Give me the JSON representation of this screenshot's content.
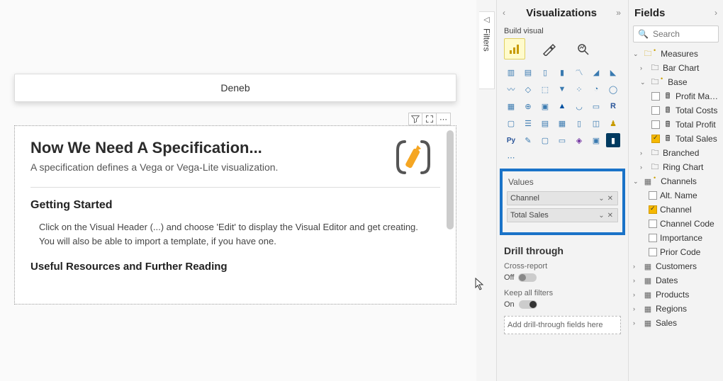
{
  "canvas": {
    "visual_title": "Deneb",
    "spec_title": "Now We Need A Specification...",
    "spec_sub": "A specification defines a Vega or Vega-Lite visualization.",
    "getting_started_title": "Getting Started",
    "getting_started_body": "Click on the Visual Header (...) and choose 'Edit' to display the Visual Editor and get creating. You will also be able to import a template, if you have one.",
    "useful_resources_title": "Useful Resources and Further Reading"
  },
  "filters": {
    "label": "Filters"
  },
  "viz": {
    "title": "Visualizations",
    "build_label": "Build visual",
    "values_label": "Values",
    "fields": [
      {
        "name": "Channel"
      },
      {
        "name": "Total Sales"
      }
    ],
    "drill_title": "Drill through",
    "cross_report_label": "Cross-report",
    "cross_report_state": "Off",
    "keep_filters_label": "Keep all filters",
    "keep_filters_state": "On",
    "drill_placeholder": "Add drill-through fields here"
  },
  "fields": {
    "title": "Fields",
    "search_placeholder": "Search",
    "measures": {
      "label": "Measures",
      "bar_chart": "Bar Chart",
      "base": {
        "label": "Base",
        "items": [
          {
            "label": "Profit Margin",
            "checked": false
          },
          {
            "label": "Total Costs",
            "checked": false
          },
          {
            "label": "Total Profit",
            "checked": false
          },
          {
            "label": "Total Sales",
            "checked": true
          }
        ]
      },
      "branched": "Branched",
      "ring_chart": "Ring Chart"
    },
    "channels": {
      "label": "Channels",
      "items": [
        {
          "label": "Alt. Name",
          "checked": false
        },
        {
          "label": "Channel",
          "checked": true
        },
        {
          "label": "Channel Code",
          "checked": false
        },
        {
          "label": "Importance",
          "checked": false
        },
        {
          "label": "Prior Code",
          "checked": false
        }
      ]
    },
    "tables": [
      "Customers",
      "Dates",
      "Products",
      "Regions",
      "Sales"
    ]
  }
}
